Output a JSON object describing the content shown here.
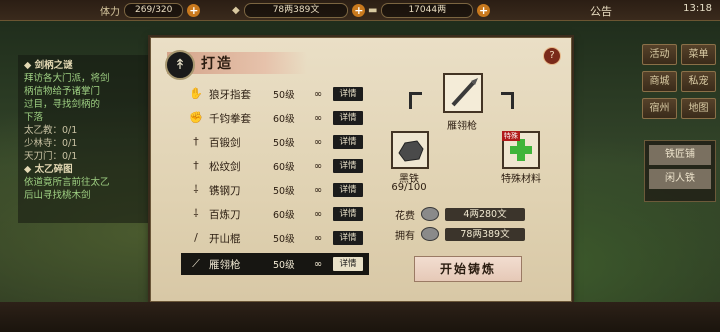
{
  "topbar": {
    "stamina_label": "体力",
    "stamina_value": "269/320",
    "silver_value": "78两389文",
    "copper_value": "17044两",
    "notice_label": "公告",
    "time": "13:18"
  },
  "quest_panel": {
    "title1": "剑柄之谜",
    "lines1": [
      "拜访各大门派，将剑",
      "柄信物给予诸掌门",
      "过目，寻找剑柄的",
      "下落"
    ],
    "p1": "太乙教：0/1",
    "p2": "少林寺：0/1",
    "p3": "天刀门：0/1",
    "title2": "太乙碎图",
    "lines2": [
      "依道竟所言前往太乙",
      "后山寻找桃木剑"
    ]
  },
  "right_buttons": [
    "活动",
    "菜单",
    "商城",
    "私宠",
    "宿州",
    "地图"
  ],
  "right_list": [
    "铁匠铺",
    "闲人铁"
  ],
  "dialog": {
    "title": "打造",
    "help": "?",
    "detail_label": "详情",
    "items": [
      {
        "name": "狼牙指套",
        "level": "50级",
        "limit": "∞"
      },
      {
        "name": "千钧拳套",
        "level": "60级",
        "limit": "∞"
      },
      {
        "name": "百锻剑",
        "level": "50级",
        "limit": "∞"
      },
      {
        "name": "松纹剑",
        "level": "60级",
        "limit": "∞"
      },
      {
        "name": "镌钢刀",
        "level": "50级",
        "limit": "∞"
      },
      {
        "name": "百炼刀",
        "level": "60级",
        "limit": "∞"
      },
      {
        "name": "开山棍",
        "level": "50级",
        "limit": "∞"
      },
      {
        "name": "雁翎枪",
        "level": "50级",
        "limit": "∞"
      }
    ],
    "selected": "雁翎枪",
    "material_name": "黑铁",
    "material_count": "69/100",
    "special_badge": "特殊",
    "special_label": "特殊材料",
    "cost_label": "花费",
    "cost_value": "4两280文",
    "own_label": "拥有",
    "own_value": "78两389文",
    "start_button": "开始铸炼"
  }
}
